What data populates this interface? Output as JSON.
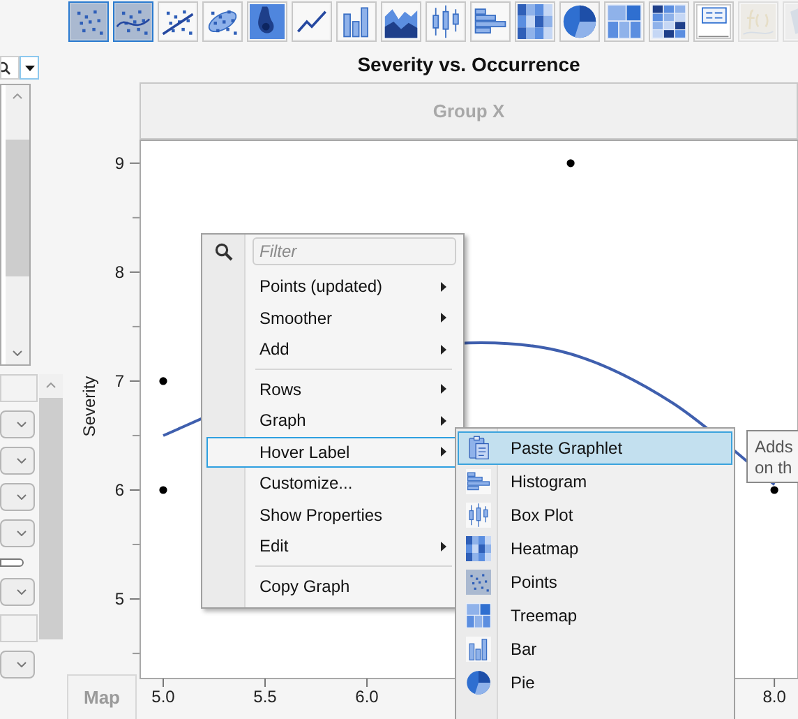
{
  "toolbar": [
    {
      "kind": "points",
      "selected": true,
      "disabled": false
    },
    {
      "kind": "smoother",
      "selected": true,
      "disabled": false
    },
    {
      "kind": "fit-line",
      "selected": false,
      "disabled": false
    },
    {
      "kind": "ellipse",
      "selected": false,
      "disabled": false
    },
    {
      "kind": "contour",
      "selected": false,
      "disabled": false
    },
    {
      "kind": "line",
      "selected": false,
      "disabled": false
    },
    {
      "kind": "bar",
      "selected": false,
      "disabled": false
    },
    {
      "kind": "area",
      "selected": false,
      "disabled": false
    },
    {
      "kind": "boxplot",
      "selected": false,
      "disabled": false
    },
    {
      "kind": "histogram",
      "selected": false,
      "disabled": false
    },
    {
      "kind": "heatmap",
      "selected": false,
      "disabled": false
    },
    {
      "kind": "pie",
      "selected": false,
      "disabled": false
    },
    {
      "kind": "treemap",
      "selected": false,
      "disabled": false
    },
    {
      "kind": "mosaic",
      "selected": false,
      "disabled": false
    },
    {
      "kind": "caption",
      "selected": false,
      "disabled": false
    },
    {
      "kind": "formula",
      "selected": false,
      "disabled": true
    },
    {
      "kind": "map",
      "selected": false,
      "disabled": true
    }
  ],
  "left_panel": {
    "controls": [
      {
        "kind": "field"
      },
      {
        "kind": "dropdown"
      },
      {
        "kind": "dropdown"
      },
      {
        "kind": "dropdown"
      },
      {
        "kind": "dropdown"
      },
      {
        "kind": "pill"
      },
      {
        "kind": "dropdown"
      },
      {
        "kind": "field"
      },
      {
        "kind": "dropdown"
      }
    ],
    "map_button": "Map"
  },
  "graph": {
    "title": "Severity vs. Occurrence",
    "group_header": "Group X",
    "chart_data": {
      "type": "scatter",
      "ylabel": "Severity",
      "xticks": [
        {
          "value": 5,
          "label": "5.0"
        },
        {
          "value": 5.5,
          "label": "5.5"
        },
        {
          "value": 6,
          "label": "6.0"
        },
        {
          "value": 8,
          "label": "8.0"
        }
      ],
      "yticks": [
        5,
        6,
        7,
        8,
        9
      ],
      "xlim": [
        4.887,
        8.116
      ],
      "ylim": [
        4.27,
        9.21
      ],
      "series": [
        {
          "color": "#000000",
          "x": [
            5,
            5,
            7,
            8
          ],
          "values": [
            7,
            6,
            9,
            6
          ]
        }
      ]
    }
  },
  "context_menu": {
    "filter_placeholder": "Filter",
    "items": [
      {
        "kind": "item",
        "label": "Points (updated)",
        "submenu": true,
        "selected": false
      },
      {
        "kind": "item",
        "label": "Smoother",
        "submenu": true,
        "selected": false
      },
      {
        "kind": "item",
        "label": "Add",
        "submenu": true,
        "selected": false
      },
      {
        "kind": "separator"
      },
      {
        "kind": "item",
        "label": "Rows",
        "submenu": true,
        "selected": false
      },
      {
        "kind": "item",
        "label": "Graph",
        "submenu": true,
        "selected": false
      },
      {
        "kind": "item",
        "label": "Hover Label",
        "submenu": true,
        "selected": true
      },
      {
        "kind": "item",
        "label": "Customize...",
        "submenu": false,
        "selected": false
      },
      {
        "kind": "item",
        "label": "Show Properties",
        "submenu": false,
        "selected": false
      },
      {
        "kind": "item",
        "label": "Edit",
        "submenu": true,
        "selected": false
      },
      {
        "kind": "separator"
      },
      {
        "kind": "item",
        "label": "Copy Graph",
        "submenu": false,
        "selected": false
      }
    ]
  },
  "submenu": {
    "items": [
      {
        "kind": "paste",
        "label": "Paste Graphlet",
        "selected": true
      },
      {
        "kind": "histogram",
        "label": "Histogram",
        "selected": false
      },
      {
        "kind": "boxplot",
        "label": "Box Plot",
        "selected": false
      },
      {
        "kind": "heatmap",
        "label": "Heatmap",
        "selected": false
      },
      {
        "kind": "points",
        "label": "Points",
        "selected": false
      },
      {
        "kind": "treemap",
        "label": "Treemap",
        "selected": false
      },
      {
        "kind": "bar",
        "label": "Bar",
        "selected": false
      },
      {
        "kind": "pie",
        "label": "Pie",
        "selected": false
      }
    ]
  },
  "tooltip": {
    "lines": [
      "Adds",
      "on th"
    ]
  }
}
